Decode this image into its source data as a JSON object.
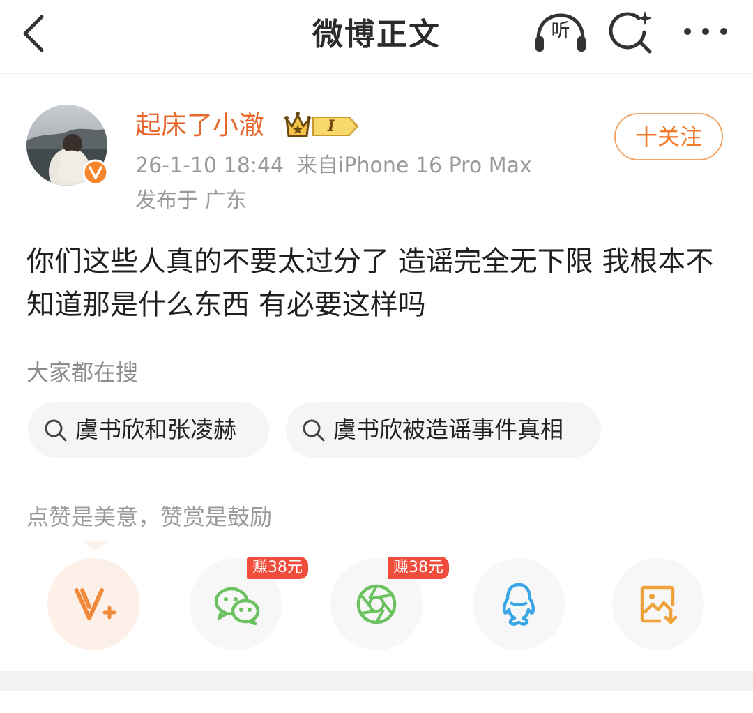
{
  "header": {
    "title": "微博正文",
    "listen_label": "听"
  },
  "author": {
    "name": "起床了小澈",
    "level": "I",
    "post_time": "26-1-10 18:44",
    "source": "来自iPhone 16 Pro Max",
    "location": "发布于 广东",
    "follow_label": "十关注"
  },
  "post": {
    "text": "你们这些人真的不要太过分了 造谣完全无下限 我根本不知道那是什么东西 有必要这样吗"
  },
  "search": {
    "title": "大家都在搜",
    "items": [
      {
        "label": "虞书欣和张凌赫"
      },
      {
        "label": "虞书欣被造谣事件真相"
      }
    ]
  },
  "appreciation": {
    "text": "点赞是美意，赞赏是鼓励"
  },
  "share": {
    "badges": [
      {
        "label": "赚38元"
      },
      {
        "label": "赚38元"
      }
    ]
  },
  "colors": {
    "accent_orange": "#e8672c",
    "follow_border": "#f0a66a",
    "badge_red": "#f04d3c",
    "wechat_green": "#6cc260",
    "qq_blue": "#3aa6e6",
    "save_orange": "#f0a23a"
  }
}
